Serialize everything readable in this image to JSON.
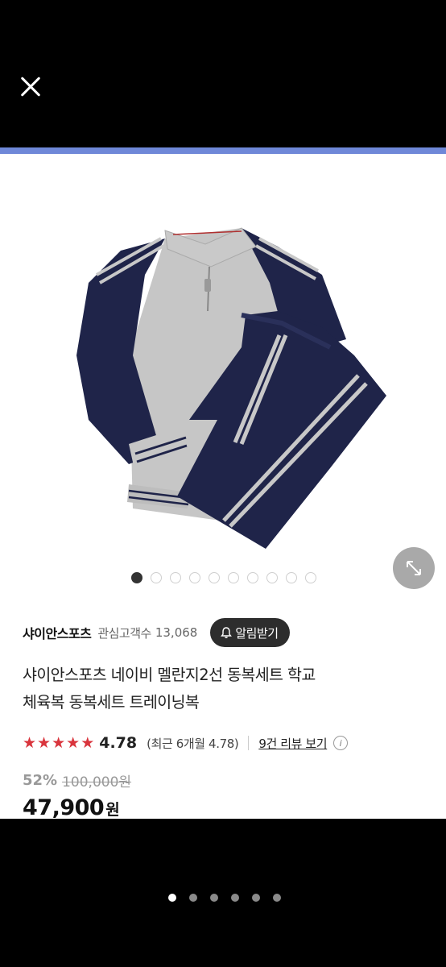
{
  "seller": {
    "name": "샤이안스포츠",
    "followers_label": "관심고객수",
    "followers_count": "13,068",
    "alert_label": "알림받기"
  },
  "product": {
    "title_line1": "샤이안스포츠 네이비 멜란지2선 동복세트 학교",
    "title_line2": "체육복 동복세트 트레이닝복"
  },
  "rating": {
    "stars": 5,
    "value": "4.78",
    "recent": "(최근 6개월 4.78)",
    "reviews_link": "9건 리뷰 보기"
  },
  "price": {
    "discount": "52%",
    "original": "100,000원",
    "final": "47,900",
    "currency": "원"
  },
  "gallery": {
    "total": 10,
    "active_index": 0
  },
  "viewer": {
    "total": 6,
    "active_index": 0
  },
  "colors": {
    "accent_strip": "#6f88d8",
    "star": "#d9353d",
    "navy": "#1e2346",
    "grey": "#c4c4c4"
  },
  "icons": {
    "close": "close-icon",
    "zoom": "expand-diagonal-icon",
    "alert": "bell-icon",
    "info": "info-icon",
    "star": "star-icon"
  }
}
